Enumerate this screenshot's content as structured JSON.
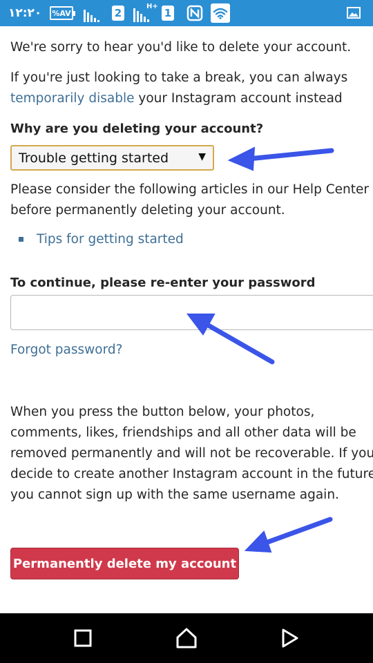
{
  "status_bar": {
    "time": "١٢:٢٠",
    "battery": "%AV",
    "sim_box_1": "2",
    "network_type": "H+",
    "sim_box_2": "1",
    "bar_color": "#2b8fd4"
  },
  "page": {
    "intro": "We're sorry to hear you'd like to delete your account.",
    "break_line_1": "If you're just looking to take a break, you can always",
    "break_link": "temporarily disable",
    "break_line_2_rest": " your Instagram account instead",
    "reason_heading": "Why are you deleting your account?",
    "reason_select_value": "Trouble getting started",
    "help_line_1": "Please consider the following articles in our Help Center",
    "help_line_2": "before permanently deleting your account.",
    "help_article_link": "Tips for getting started",
    "password_label": "To continue, please re-enter your password",
    "password_value": "",
    "forgot_password_link": "Forgot password?",
    "warning_lines": [
      "When you press the button below, your photos,",
      "comments, likes, friendships and all other data will be",
      "removed permanently and will not be recoverable. If you",
      "decide to create another Instagram account in the future,",
      "you cannot sign up with the same username again."
    ],
    "delete_button": "Permanently delete my account",
    "link_color": "#3e6f96",
    "delete_color": "#d0394b"
  },
  "annotations": {
    "arrow_color": "#3a55e8"
  },
  "nav_bar": {
    "icons": [
      "recent-apps-icon",
      "home-icon",
      "back-icon"
    ]
  }
}
